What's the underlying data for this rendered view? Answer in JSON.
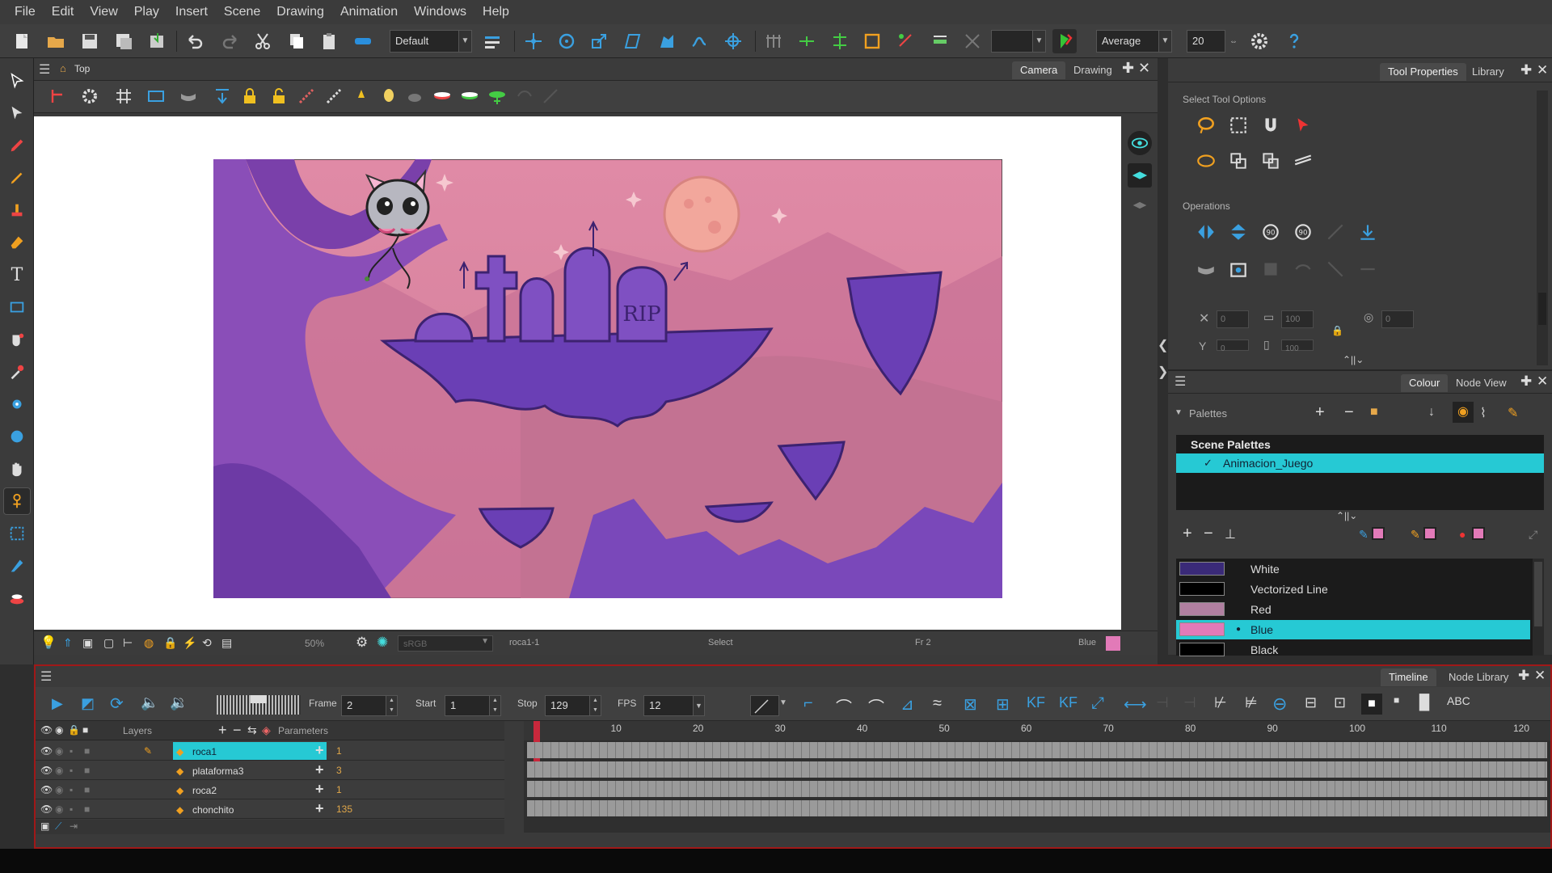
{
  "menu": [
    "File",
    "Edit",
    "View",
    "Play",
    "Insert",
    "Scene",
    "Drawing",
    "Animation",
    "Windows",
    "Help"
  ],
  "toolbar": {
    "workspace_combo": "Default",
    "smoothing_combo": "Average",
    "size_value": "20"
  },
  "camera": {
    "breadcrumb": "Top",
    "tabs": [
      "Camera",
      "Drawing"
    ],
    "footer": {
      "zoom": "50%",
      "colorspace": "sRGB",
      "drawing_name": "roca1-1",
      "tool": "Select",
      "frame": "Fr 2",
      "colour_name": "Blue"
    },
    "tombstone_text": "RIP"
  },
  "tool_properties": {
    "tabs": [
      "Tool Properties",
      "Library"
    ],
    "select_tool_options_label": "Select Tool Options",
    "operations_label": "Operations",
    "fields": {
      "x": "0",
      "w": "100",
      "y": "0",
      "h": "100",
      "angle": "0"
    }
  },
  "colour_panel": {
    "tabs": [
      "Colour",
      "Node View"
    ],
    "palettes_label": "Palettes",
    "scene_palettes_label": "Scene Palettes",
    "palette_name": "Animacion_Juego",
    "colours": [
      {
        "name": "White",
        "swatch": "#3a2a78"
      },
      {
        "name": "Vectorized Line",
        "swatch": "#000000"
      },
      {
        "name": "Red",
        "swatch": "#b07fa0"
      },
      {
        "name": "Blue",
        "swatch": "#e27ab8",
        "selected": true
      },
      {
        "name": "Black",
        "swatch": "#000000"
      }
    ]
  },
  "timeline": {
    "tabs": [
      "Timeline",
      "Node Library"
    ],
    "frame_label": "Frame",
    "frame_value": "2",
    "start_label": "Start",
    "start_value": "1",
    "stop_label": "Stop",
    "stop_value": "129",
    "fps_label": "FPS",
    "fps_value": "12",
    "layers_label": "Layers",
    "parameters_label": "Parameters",
    "layers": [
      {
        "name": "roca1",
        "param": "1",
        "selected": true
      },
      {
        "name": "plataforma3",
        "param": "3"
      },
      {
        "name": "roca2",
        "param": "1"
      },
      {
        "name": "chonchito",
        "param": "135"
      }
    ],
    "ruler": [
      "10",
      "20",
      "30",
      "40",
      "50",
      "60",
      "70",
      "80",
      "90",
      "100",
      "110",
      "120"
    ]
  },
  "colors": {
    "accent": "#26c9d4",
    "sky": "#d98aa8",
    "platform": "#6b3fb5",
    "moon": "#f0a7a0",
    "timeline_border": "#a01818"
  }
}
